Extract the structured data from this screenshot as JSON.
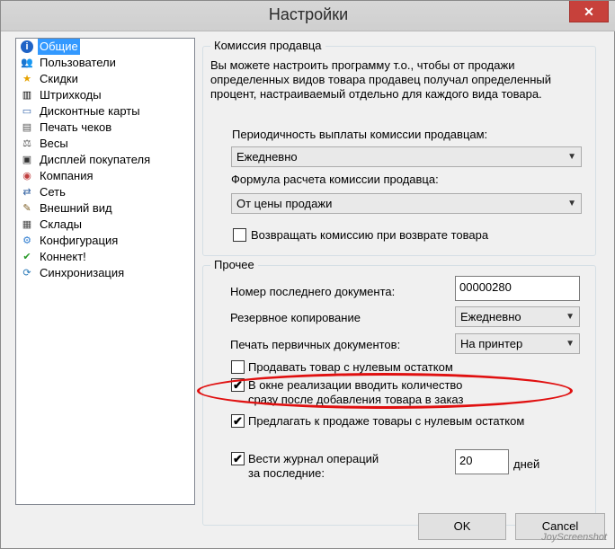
{
  "window": {
    "title": "Настройки",
    "close_glyph": "✕"
  },
  "sidebar": {
    "items": [
      {
        "label": "Общие",
        "icon": "info-icon",
        "glyph": "i",
        "color": "#1f63c6",
        "selected": true
      },
      {
        "label": "Пользователи",
        "icon": "users-icon",
        "glyph": "👥",
        "color": "#3a6ea5"
      },
      {
        "label": "Скидки",
        "icon": "star-icon",
        "glyph": "★",
        "color": "#e6a200"
      },
      {
        "label": "Штрихкоды",
        "icon": "barcode-icon",
        "glyph": "▥",
        "color": "#000000"
      },
      {
        "label": "Дисконтные карты",
        "icon": "card-icon",
        "glyph": "▭",
        "color": "#2b5fa8"
      },
      {
        "label": "Печать чеков",
        "icon": "receipt-icon",
        "glyph": "▤",
        "color": "#555555"
      },
      {
        "label": "Весы",
        "icon": "scales-icon",
        "glyph": "⚖",
        "color": "#555555"
      },
      {
        "label": "Дисплей покупателя",
        "icon": "display-icon",
        "glyph": "▣",
        "color": "#333333"
      },
      {
        "label": "Компания",
        "icon": "company-icon",
        "glyph": "◉",
        "color": "#c04040"
      },
      {
        "label": "Сеть",
        "icon": "network-icon",
        "glyph": "⇄",
        "color": "#3060a0"
      },
      {
        "label": "Внешний вид",
        "icon": "appearance-icon",
        "glyph": "✎",
        "color": "#7a5a20"
      },
      {
        "label": "Склады",
        "icon": "warehouse-icon",
        "glyph": "▦",
        "color": "#4a4a4a"
      },
      {
        "label": "Конфигурация",
        "icon": "config-icon",
        "glyph": "⚙",
        "color": "#2f7dd0"
      },
      {
        "label": "Коннект!",
        "icon": "connect-icon",
        "glyph": "✔",
        "color": "#2a9a2a"
      },
      {
        "label": "Синхронизация",
        "icon": "sync-icon",
        "glyph": "⟳",
        "color": "#2a7ab8"
      }
    ]
  },
  "commission": {
    "title": "Комиссия продавца",
    "description": "Вы можете настроить программу т.о., чтобы от продажи определенных видов товара продавец получал определенный процент, настраиваемый отдельно для каждого вида товара.",
    "period_label": "Периодичность выплаты комиссии продавцам:",
    "period_value": "Ежедневно",
    "formula_label": "Формула расчета комиссии продавца:",
    "formula_value": "От цены продажи",
    "refund_label": "Возвращать комиссию при возврате товара",
    "refund_checked": false
  },
  "other": {
    "title": "Прочее",
    "last_doc_label": "Номер последнего документа:",
    "last_doc_value": "00000280",
    "backup_label": "Резервное копирование",
    "backup_value": "Ежедневно",
    "print_label": "Печать первичных документов:",
    "print_value": "На принтер",
    "zero_stock_label": "Продавать товар с нулевым остатком",
    "zero_stock_checked": false,
    "enter_qty_label": "В окне реализации вводить количество сразу после добавления товара в заказ",
    "enter_qty_line1": "В окне реализации вводить количество",
    "enter_qty_line2": "сразу после добавления товара в заказ",
    "enter_qty_checked": true,
    "offer_zero_label": "Предлагать к продаже товары с нулевым остатком",
    "offer_zero_checked": true,
    "journal_line1": "Вести журнал операций",
    "journal_line2": "за последние:",
    "journal_checked": true,
    "journal_days_value": "20",
    "journal_days_unit": "дней"
  },
  "buttons": {
    "ok": "OK",
    "cancel": "Cancel"
  },
  "watermark": "JoyScreenshot",
  "colors": {
    "selection": "#3399ff",
    "highlight_ellipse": "#e01010",
    "close_button": "#c7413b"
  }
}
